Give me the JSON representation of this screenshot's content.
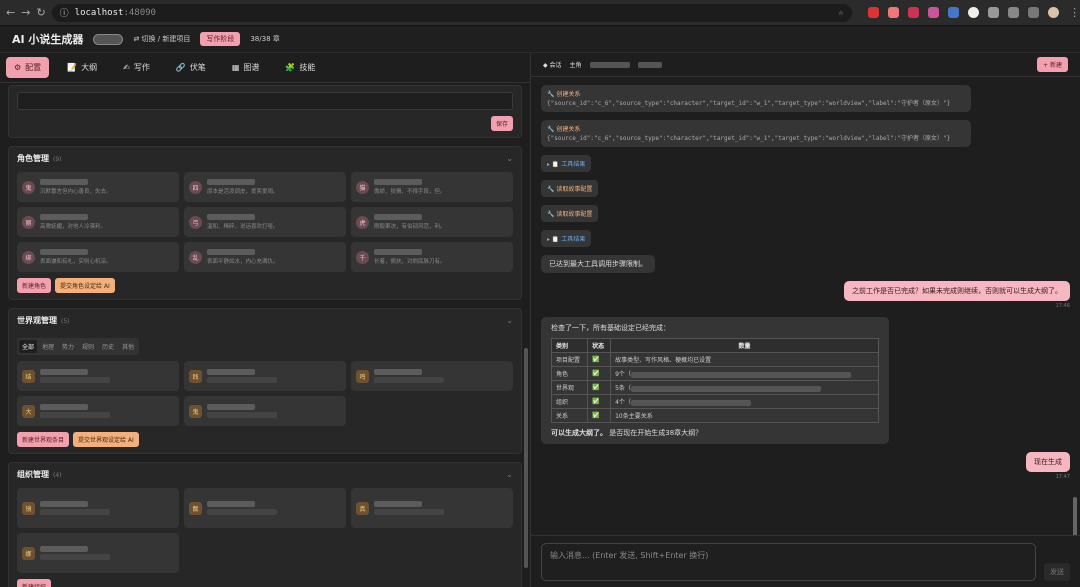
{
  "browser": {
    "host": "localhost",
    "port": ":48090"
  },
  "app": {
    "title": "AI 小说生成器",
    "switch_label": "⇄ 切换 / 新建项目",
    "stage": "写作阶段",
    "count": "38/38 章"
  },
  "tabs": [
    {
      "icon": "⚙",
      "label": "配置"
    },
    {
      "icon": "📝",
      "label": "大纲"
    },
    {
      "icon": "✍",
      "label": "写作"
    },
    {
      "icon": "🔗",
      "label": "伏笔"
    },
    {
      "icon": "▦",
      "label": "图谱"
    },
    {
      "icon": "🧩",
      "label": "技能"
    }
  ],
  "config": {
    "save_label": "保存"
  },
  "characters": {
    "title": "角色管理",
    "count": "(9)",
    "items": [
      {
        "av": "鬼",
        "desc": "沉默寡言但内心善良，失去。"
      },
      {
        "av": "四",
        "desc": "原本是活泼调皮，爱笑爱闹。"
      },
      {
        "av": "猫",
        "desc": "傲娇、狡猾、不择手段，但。"
      },
      {
        "av": "丽",
        "desc": "高傲妩媚，对他人冷漠利。"
      },
      {
        "av": "弓",
        "desc": "温和、稀碎，说话喜欢打哑。"
      },
      {
        "av": "虎",
        "desc": "刚毅果决，有伯韧风范，利。"
      },
      {
        "av": "绑",
        "desc": "表面谦和有礼，实则心机深。"
      },
      {
        "av": "乱",
        "desc": "表面平静如水，内心充满仇。"
      },
      {
        "av": "千",
        "desc": "长着，佩扶，对刷底脉刀有。"
      }
    ],
    "new_label": "新建角色",
    "ai_label": "提交角色设定给 AI"
  },
  "world": {
    "title": "世界观管理",
    "count": "(5)",
    "subtabs": [
      "全部",
      "地理",
      "势力",
      "规则",
      "历史",
      "其他"
    ],
    "items": [
      {
        "av": "结"
      },
      {
        "av": "践"
      },
      {
        "av": "鸣"
      },
      {
        "av": "大"
      },
      {
        "av": "鬼"
      }
    ],
    "new_label": "新建世界观条目",
    "ai_label": "提交世界观设定给 AI"
  },
  "orgs": {
    "title": "组织管理",
    "count": "(4)",
    "items": [
      {
        "av": "镜"
      },
      {
        "av": "靓"
      },
      {
        "av": "真"
      },
      {
        "av": "娜"
      }
    ],
    "new_label": "新建组织"
  },
  "right": {
    "session_label": "◆ 会话",
    "lead_label": "主角",
    "new_label": "+ 新建"
  },
  "chat": {
    "tool1": {
      "name": "🔧 创建关系",
      "args": "{\"source_id\":\"c_6\",\"source_type\":\"character\",\"target_id\":\"w_1\",\"target_type\":\"worldview\",\"label\":\"守护者（原女）\"}"
    },
    "tool2": {
      "name": "🔧 创建关系",
      "args": "{\"source_id\":\"c_6\",\"source_type\":\"character\",\"target_id\":\"w_1\",\"target_type\":\"worldview\",\"label\":\"守护者（原女）\"}"
    },
    "result1": "▸ 📋 工具结果",
    "read1": "🔧 读取故事配置",
    "read2": "🔧 读取故事配置",
    "result2": "▸ 📋 工具结果",
    "sys": "已达到最大工具调用步骤限制。",
    "user1": "之前工作是否已完成？如果未完成则继续，否则就可以生成大纲了。",
    "time1": "17:46",
    "ai_intro": "检查了一下，所有基础设定已经完成：",
    "table": {
      "headers": [
        "类别",
        "状态",
        "数量"
      ],
      "rows": [
        {
          "cat": "项目配置",
          "status": "✅",
          "qty": "故事类型、写作风格、梗概均已设置"
        },
        {
          "cat": "角色",
          "status": "✅",
          "qty": "9个（"
        },
        {
          "cat": "世界观",
          "status": "✅",
          "qty": "5条（"
        },
        {
          "cat": "组织",
          "status": "✅",
          "qty": "4个（"
        },
        {
          "cat": "关系",
          "status": "✅",
          "qty": "10条主要关系"
        }
      ]
    },
    "ai_bold": "可以生成大纲了。",
    "ai_tail": "是否现在开始生成38章大纲？",
    "user2": "现在生成",
    "time2": "17:47"
  },
  "input": {
    "placeholder": "输入消息... (Enter 发送, Shift+Enter 换行)",
    "send_label": "发送"
  }
}
